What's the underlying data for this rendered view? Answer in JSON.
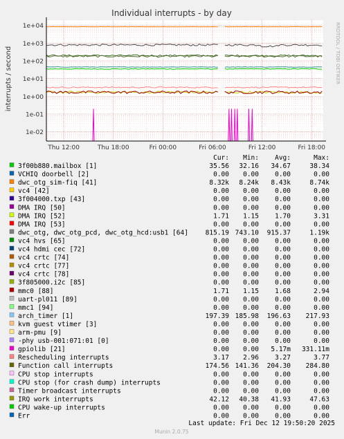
{
  "chart_data": {
    "type": "line",
    "title": "Individual interrupts - by day",
    "ylabel": "interrupts / second",
    "yscale": "log",
    "ylim": [
      0.003,
      20000
    ],
    "y_ticks": [
      "1e-02",
      "1e-01",
      "1e+00",
      "1e+01",
      "1e+02",
      "1e+03",
      "1e+04"
    ],
    "x_ticks": [
      "Thu 12:00",
      "Thu 18:00",
      "Fri 00:00",
      "Fri 06:00",
      "Fri 12:00",
      "Fri 18:00"
    ],
    "grid": true,
    "watermark": "RRDTOOL / TOBI OETIKER",
    "series_lines": [
      {
        "color": "#ff7f00",
        "approx": 8400,
        "noise": 0.02
      },
      {
        "color": "#00cc00",
        "approx": 35,
        "noise": 0.05
      },
      {
        "color": "#4a4a4a",
        "approx": 790,
        "noise": 0.12
      },
      {
        "color": "#3c6e28",
        "approx": 200,
        "noise": 0.1
      },
      {
        "color": "#556b2f",
        "approx": 180,
        "noise": 0.12
      },
      {
        "color": "#2f8f8f",
        "approx": 45,
        "noise": 0.03
      },
      {
        "color": "#ff8080",
        "approx": 3.2,
        "noise": 0.08
      },
      {
        "color": "#cccc00",
        "approx": 1.7,
        "noise": 0.15
      },
      {
        "color": "#990000",
        "approx": 1.7,
        "noise": 0.18
      }
    ]
  },
  "table": {
    "headers": [
      "Cur:",
      "Min:",
      "Avg:",
      "Max:"
    ],
    "rows": [
      {
        "color": "#00cc00",
        "name": "3f00b880.mailbox [1]",
        "cur": "35.56",
        "min": "32.16",
        "avg": "34.67",
        "max": "38.34"
      },
      {
        "color": "#0066b3",
        "name": "VCHIQ doorbell [2]",
        "cur": "0.00",
        "min": "0.00",
        "avg": "0.00",
        "max": "0.00"
      },
      {
        "color": "#ff8000",
        "name": "dwc_otg_sim-fiq [41]",
        "cur": "8.32k",
        "min": "8.24k",
        "avg": "8.43k",
        "max": "8.74k"
      },
      {
        "color": "#ffcc00",
        "name": "vc4 [42]",
        "cur": "0.00",
        "min": "0.00",
        "avg": "0.00",
        "max": "0.00"
      },
      {
        "color": "#330099",
        "name": "3f004000.txp [43]",
        "cur": "0.00",
        "min": "0.00",
        "avg": "0.00",
        "max": "0.00"
      },
      {
        "color": "#990099",
        "name": "DMA IRQ [50]",
        "cur": "0.00",
        "min": "0.00",
        "avg": "0.00",
        "max": "0.00"
      },
      {
        "color": "#ccff00",
        "name": "DMA IRQ [52]",
        "cur": "1.71",
        "min": "1.15",
        "avg": "1.70",
        "max": "3.31"
      },
      {
        "color": "#ff0000",
        "name": "DMA IRQ [53]",
        "cur": "0.00",
        "min": "0.00",
        "avg": "0.00",
        "max": "0.00"
      },
      {
        "color": "#808080",
        "name": "dwc_otg, dwc_otg_pcd, dwc_otg_hcd:usb1 [64]",
        "cur": "815.19",
        "min": "743.10",
        "avg": "915.37",
        "max": "1.19k"
      },
      {
        "color": "#008f00",
        "name": "vc4 hvs [65]",
        "cur": "0.00",
        "min": "0.00",
        "avg": "0.00",
        "max": "0.00"
      },
      {
        "color": "#00487d",
        "name": "vc4 hdmi cec [72]",
        "cur": "0.00",
        "min": "0.00",
        "avg": "0.00",
        "max": "0.00"
      },
      {
        "color": "#b35a00",
        "name": "vc4 crtc [74]",
        "cur": "0.00",
        "min": "0.00",
        "avg": "0.00",
        "max": "0.00"
      },
      {
        "color": "#b38f00",
        "name": "vc4 crtc [77]",
        "cur": "0.00",
        "min": "0.00",
        "avg": "0.00",
        "max": "0.00"
      },
      {
        "color": "#6b006b",
        "name": "vc4 crtc [78]",
        "cur": "0.00",
        "min": "0.00",
        "avg": "0.00",
        "max": "0.00"
      },
      {
        "color": "#8fb300",
        "name": "3f805000.i2c [85]",
        "cur": "0.00",
        "min": "0.00",
        "avg": "0.00",
        "max": "0.00"
      },
      {
        "color": "#b30000",
        "name": "mmc0 [88]",
        "cur": "1.71",
        "min": "1.15",
        "avg": "1.68",
        "max": "2.94"
      },
      {
        "color": "#bebebe",
        "name": "uart-pl011 [89]",
        "cur": "0.00",
        "min": "0.00",
        "avg": "0.00",
        "max": "0.00"
      },
      {
        "color": "#80ff80",
        "name": "mmc1 [94]",
        "cur": "0.00",
        "min": "0.00",
        "avg": "0.00",
        "max": "0.00"
      },
      {
        "color": "#80c9ff",
        "name": "arch_timer [1]",
        "cur": "197.39",
        "min": "185.98",
        "avg": "196.63",
        "max": "217.93"
      },
      {
        "color": "#ffc080",
        "name": "kvm guest vtimer [3]",
        "cur": "0.00",
        "min": "0.00",
        "avg": "0.00",
        "max": "0.00"
      },
      {
        "color": "#ffe680",
        "name": "arm-pmu [9]",
        "cur": "0.00",
        "min": "0.00",
        "avg": "0.00",
        "max": "0.00"
      },
      {
        "color": "#aa80ff",
        "name": "-phy        usb-001:071:01 [0]",
        "cur": "0.00",
        "min": "0.00",
        "avg": "0.00",
        "max": "0.00"
      },
      {
        "color": "#ee00cc",
        "name": "gpiolib [21]",
        "cur": "0.00",
        "min": "0.00",
        "avg": "5.17m",
        "max": "331.11m"
      },
      {
        "color": "#ff8080",
        "name": "Rescheduling interrupts",
        "cur": "3.17",
        "min": "2.96",
        "avg": "3.27",
        "max": "3.77"
      },
      {
        "color": "#666600",
        "name": "Function call interrupts",
        "cur": "174.56",
        "min": "141.36",
        "avg": "204.30",
        "max": "284.80"
      },
      {
        "color": "#ffbfff",
        "name": "CPU stop interrupts",
        "cur": "0.00",
        "min": "0.00",
        "avg": "0.00",
        "max": "0.00"
      },
      {
        "color": "#00ffcc",
        "name": "CPU stop (for crash dump) interrupts",
        "cur": "0.00",
        "min": "0.00",
        "avg": "0.00",
        "max": "0.00"
      },
      {
        "color": "#cc6699",
        "name": "Timer broadcast interrupts",
        "cur": "0.00",
        "min": "0.00",
        "avg": "0.00",
        "max": "0.00"
      },
      {
        "color": "#999900",
        "name": "IRQ work interrupts",
        "cur": "42.12",
        "min": "40.38",
        "avg": "41.93",
        "max": "47.63"
      },
      {
        "color": "#00cc00",
        "name": "CPU wake-up interrupts",
        "cur": "0.00",
        "min": "0.00",
        "avg": "0.00",
        "max": "0.00"
      },
      {
        "color": "#0066b3",
        "name": "Err",
        "cur": "0.00",
        "min": "0.00",
        "avg": "0.00",
        "max": "0.00"
      }
    ]
  },
  "footer": {
    "last_update": "Last update: Fri Dec 12 19:50:20 2025",
    "version": "Munin 2.0.75"
  }
}
